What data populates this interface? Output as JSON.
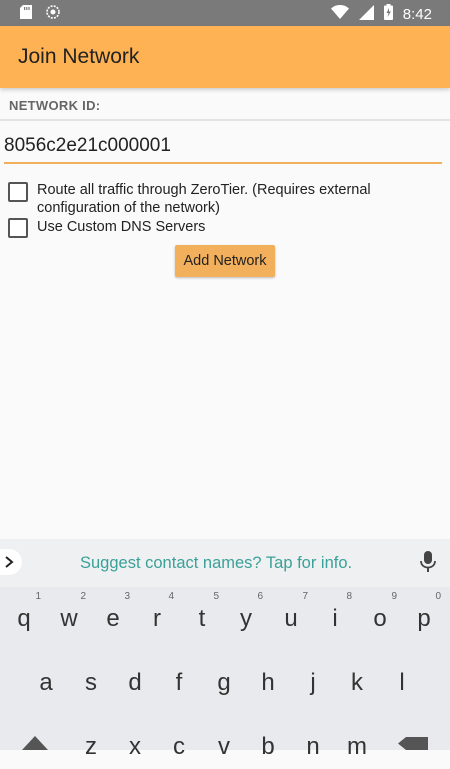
{
  "statusbar": {
    "time": "8:42"
  },
  "appbar": {
    "title": "Join Network"
  },
  "form": {
    "network_id_label": "NETWORK ID:",
    "network_id_value": "8056c2e21c000001",
    "route_all_label": "Route all traffic through ZeroTier. (Requires external configuration of the network)",
    "route_all_checked": false,
    "custom_dns_label": "Use Custom DNS Servers",
    "custom_dns_checked": false,
    "add_button_label": "Add Network"
  },
  "keyboard": {
    "suggestion_text": "Suggest contact names? Tap for info.",
    "row1": [
      "q",
      "w",
      "e",
      "r",
      "t",
      "y",
      "u",
      "i",
      "o",
      "p"
    ],
    "row1_hints": [
      "1",
      "2",
      "3",
      "4",
      "5",
      "6",
      "7",
      "8",
      "9",
      "0"
    ],
    "row2": [
      "a",
      "s",
      "d",
      "f",
      "g",
      "h",
      "j",
      "k",
      "l"
    ],
    "row3": [
      "z",
      "x",
      "c",
      "v",
      "b",
      "n",
      "m"
    ]
  },
  "colors": {
    "accent": "#ffb253",
    "status_bar": "#7a7a7a",
    "suggestion": "#3aa198"
  }
}
